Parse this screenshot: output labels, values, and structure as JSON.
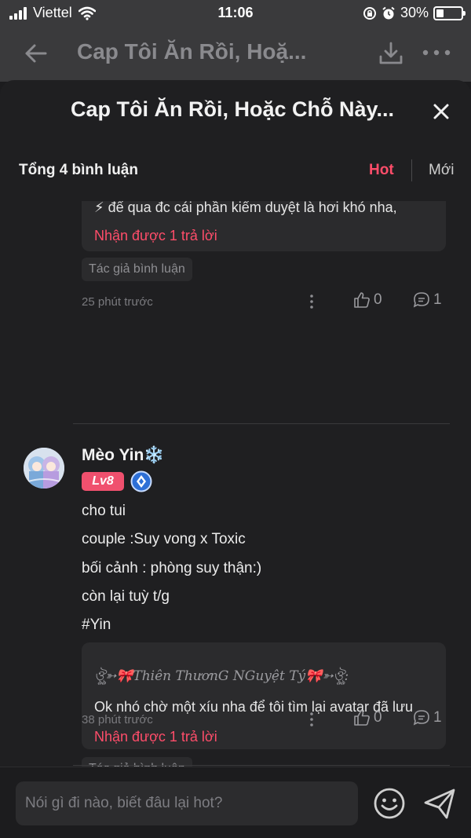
{
  "status_bar": {
    "carrier": "Viettel",
    "time": "11:06",
    "battery": "30%",
    "battery_level": 0.3,
    "icons": [
      "signal-icon",
      "wifi-icon",
      "rotation-lock-icon",
      "alarm-icon",
      "battery-icon"
    ]
  },
  "nav": {
    "title": "Cap Tôi Ăn Rồi, Hoặ...",
    "icons": [
      "back-arrow-icon",
      "download-icon",
      "more-icon"
    ]
  },
  "sheet": {
    "title": "Cap Tôi Ăn Rồi, Hoặc Chỗ Này...",
    "close_icon": "close-icon"
  },
  "comments_header": {
    "count_label": "Tổng 4 bình luận",
    "sort_hot": "Hot",
    "sort_new": "Mới",
    "accent": "#ff4d6a"
  },
  "comments": [
    {
      "reply_preview": {
        "text": "⚡ để qua đc cái phần kiểm duyệt là hơi khó nha,",
        "reply_count": "Nhận được 1 trả lời"
      },
      "author_tag": "Tác giả bình luận",
      "time": "25 phút trước",
      "likes": "0",
      "comments": "1"
    },
    {
      "username": "Mèo Yin❄️",
      "level": "Lv8",
      "lines": [
        "cho tui",
        "couple :Suy vong x Toxic",
        "bối cảnh : phòng suy thận:)",
        "còn lại tuỳ t/g",
        "#Yin"
      ],
      "reply_preview": {
        "author": "ঔৣ➳🎀Thiên ThươnG NGuyệt Tý🎀➳ঔৣ:",
        "text": "Ok nhó chờ một xíu nha để tôi tìm lại avatar đã lưu",
        "reply_count": "Nhận được 1 trả lời"
      },
      "author_tag": "Tác giả bình luận",
      "time": "38 phút trước",
      "likes": "0",
      "comments": "1"
    }
  ],
  "input": {
    "placeholder": "Nói gì đi nào, biết đâu lại hot?"
  },
  "colors": {
    "background": "#1c1c1e",
    "sheet": "#1f1f21",
    "card": "#2b2b2d",
    "level_badge": "#f0506e"
  }
}
